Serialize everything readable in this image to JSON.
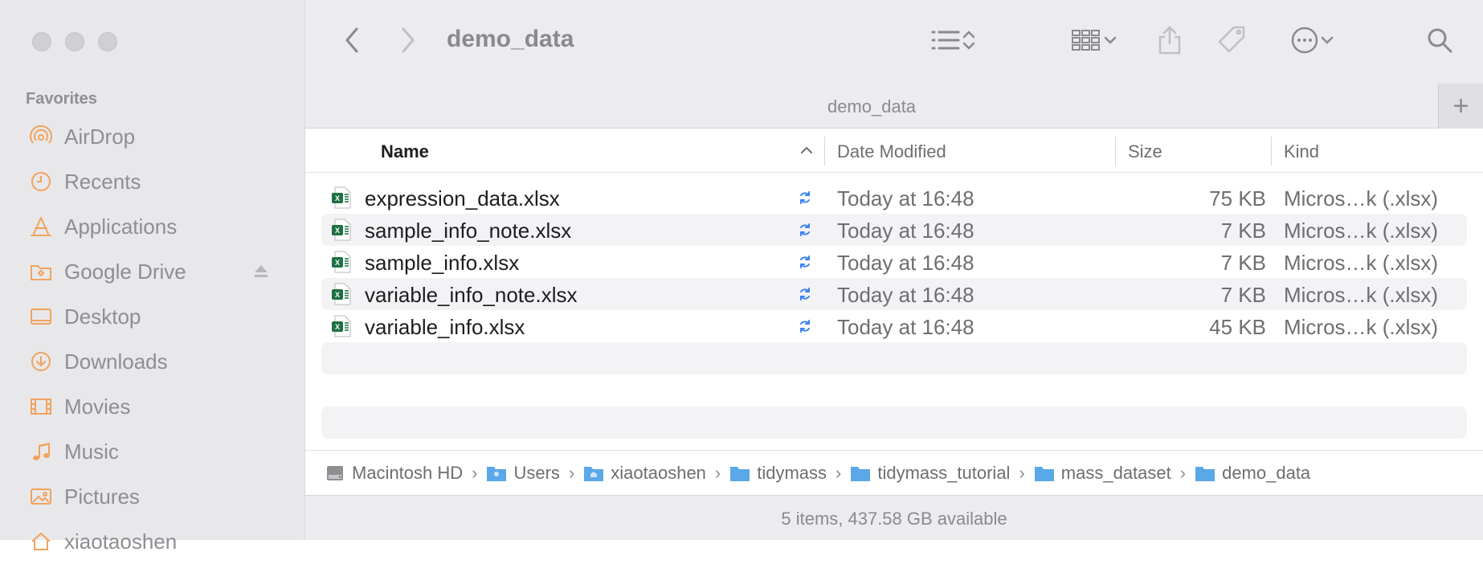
{
  "sidebar": {
    "section_label": "Favorites",
    "items": [
      {
        "label": "AirDrop",
        "icon": "airdrop-icon"
      },
      {
        "label": "Recents",
        "icon": "clock-icon"
      },
      {
        "label": "Applications",
        "icon": "applications-icon"
      },
      {
        "label": "Google Drive",
        "icon": "folder-icon"
      },
      {
        "label": "Desktop",
        "icon": "desktop-icon"
      },
      {
        "label": "Downloads",
        "icon": "downloads-icon"
      },
      {
        "label": "Movies",
        "icon": "film-icon"
      },
      {
        "label": "Music",
        "icon": "music-note-icon"
      },
      {
        "label": "Pictures",
        "icon": "photo-icon"
      },
      {
        "label": "xiaotaoshen",
        "icon": "home-icon"
      }
    ],
    "accent_color": "#f0a35e"
  },
  "toolbar": {
    "title": "demo_data"
  },
  "tab": {
    "title": "demo_data",
    "add_label": "+"
  },
  "columns": {
    "name": "Name",
    "date_modified": "Date Modified",
    "size": "Size",
    "kind": "Kind"
  },
  "files": [
    {
      "name": "expression_data.xlsx",
      "date": "Today at 16:48",
      "size": "75 KB",
      "kind": "Micros…k (.xlsx)"
    },
    {
      "name": "sample_info_note.xlsx",
      "date": "Today at 16:48",
      "size": "7 KB",
      "kind": "Micros…k (.xlsx)"
    },
    {
      "name": "sample_info.xlsx",
      "date": "Today at 16:48",
      "size": "7 KB",
      "kind": "Micros…k (.xlsx)"
    },
    {
      "name": "variable_info_note.xlsx",
      "date": "Today at 16:48",
      "size": "7 KB",
      "kind": "Micros…k (.xlsx)"
    },
    {
      "name": "variable_info.xlsx",
      "date": "Today at 16:48",
      "size": "45 KB",
      "kind": "Micros…k (.xlsx)"
    }
  ],
  "path": [
    {
      "label": "Macintosh HD",
      "icon": "hard-drive-icon"
    },
    {
      "label": "Users",
      "icon": "folder-icon"
    },
    {
      "label": "xiaotaoshen",
      "icon": "home-folder-icon"
    },
    {
      "label": "tidymass",
      "icon": "folder-icon"
    },
    {
      "label": "tidymass_tutorial",
      "icon": "folder-icon"
    },
    {
      "label": "mass_dataset",
      "icon": "folder-icon"
    },
    {
      "label": "demo_data",
      "icon": "folder-icon"
    }
  ],
  "status": {
    "text": "5 items, 437.58 GB available"
  },
  "colors": {
    "excel_green": "#1e7145",
    "sync_blue": "#3b82f6",
    "folder_blue": "#5aa8e8"
  }
}
